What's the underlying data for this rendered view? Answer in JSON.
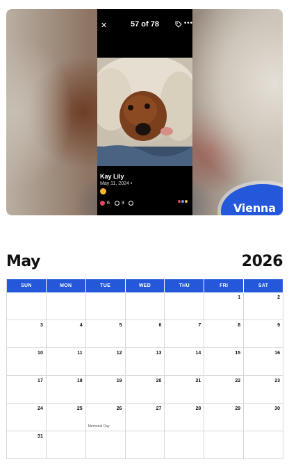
{
  "post": {
    "counter": "57 of 78",
    "user_name": "Kay Lily",
    "date": "May 11, 2024 •",
    "likes": "6",
    "comments": "3"
  },
  "name_badge": "Vienna",
  "calendar": {
    "month": "May",
    "year": "2026",
    "weekdays": [
      "SUN",
      "MON",
      "TUE",
      "WED",
      "THU",
      "FRI",
      "SAT"
    ],
    "weeks": [
      [
        "",
        "",
        "",
        "",
        "",
        "1",
        "2"
      ],
      [
        "3",
        "4",
        "5",
        "6",
        "7",
        "8",
        "9"
      ],
      [
        "10",
        "11",
        "12",
        "13",
        "14",
        "15",
        "16"
      ],
      [
        "17",
        "18",
        "19",
        "20",
        "21",
        "22",
        "23"
      ],
      [
        "24",
        "25",
        "26",
        "27",
        "28",
        "29",
        "30"
      ],
      [
        "31",
        "",
        "",
        "",
        "",
        "",
        ""
      ]
    ],
    "holiday": {
      "week": 4,
      "day": 2,
      "label": "Memorial Day"
    }
  },
  "colors": {
    "accent_blue": "#2457d9",
    "grid_line": "#d8d8d8"
  },
  "icons": [
    "close-icon",
    "tag-icon",
    "more-icon",
    "heart-icon",
    "comment-icon",
    "share-icon"
  ]
}
